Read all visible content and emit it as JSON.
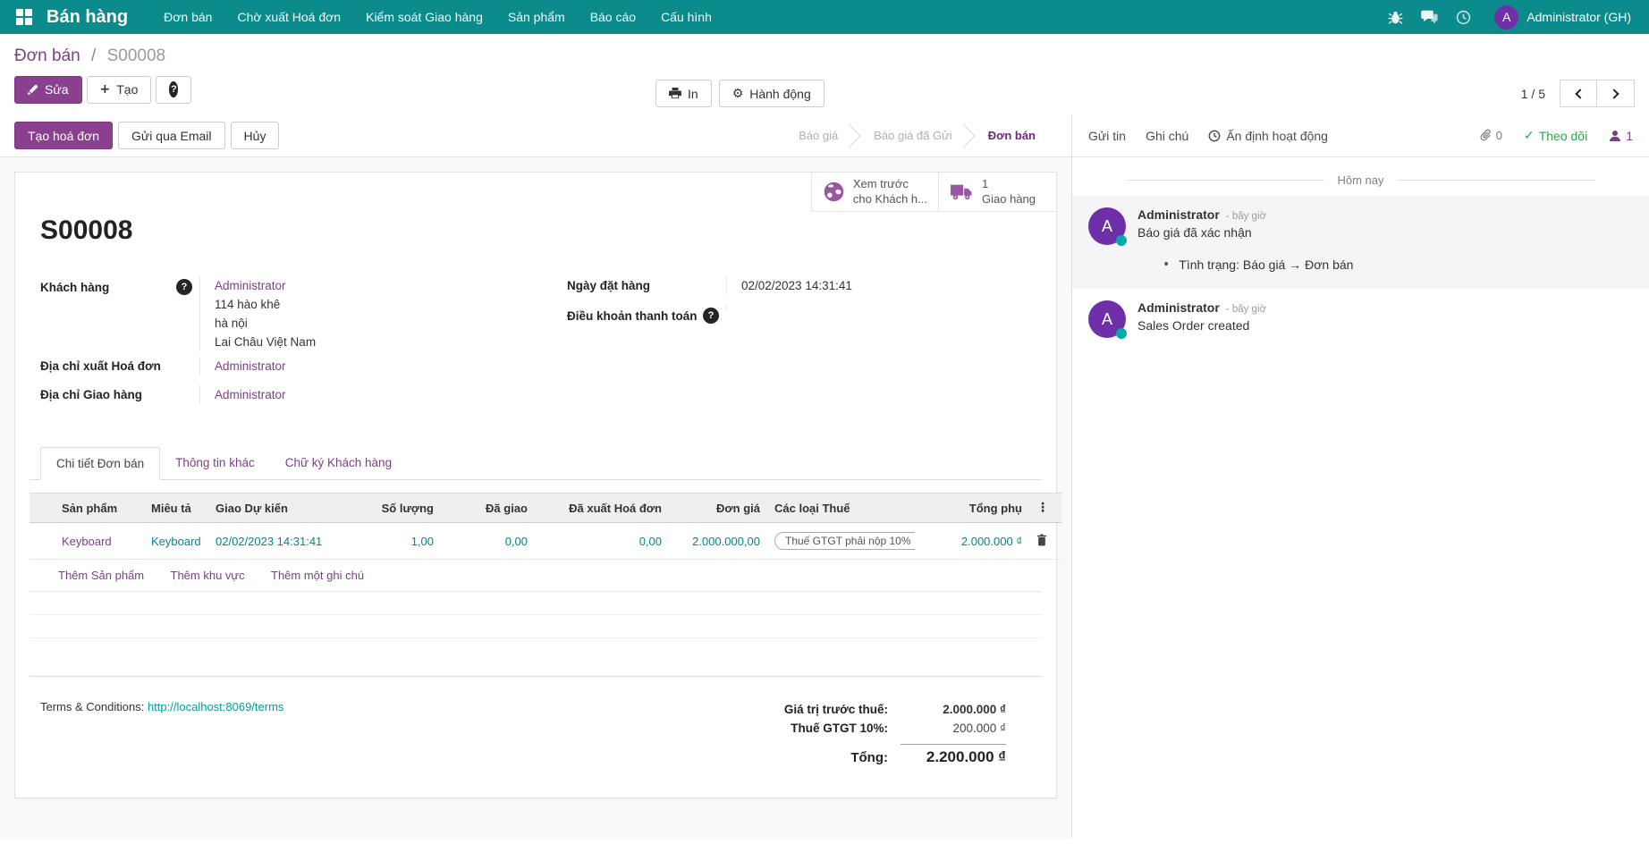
{
  "colors": {
    "nav_teal": "#0c8b8d",
    "accent_purple": "#8a3f8f",
    "link_purple": "#7c3f87",
    "value_teal": "#00878a",
    "terms_teal": "#00a09d",
    "follow_green": "#28a745",
    "avatar_purple": "#6e2fa8"
  },
  "nav": {
    "brand": "Bán hàng",
    "items": [
      "Đơn bán",
      "Chờ xuất Hoá đơn",
      "Kiểm soát Giao hàng",
      "Sản phẩm",
      "Báo cáo",
      "Cấu hình"
    ],
    "systray_icons": [
      "bug-icon",
      "chat-icon",
      "clock-icon"
    ],
    "user": {
      "initial": "A",
      "name": "Administrator (GH)"
    }
  },
  "breadcrumb": {
    "parent": "Đơn bán",
    "separator": "/",
    "current": "S00008"
  },
  "control_panel": {
    "edit_label": "Sửa",
    "create_label": "Tạo",
    "print_label": "In",
    "action_label": "Hành động",
    "pager_value": "1 / 5"
  },
  "statusbar": {
    "buttons": [
      {
        "label": "Tạo hoá đơn"
      },
      {
        "label": "Gửi qua Email"
      },
      {
        "label": "Hủy"
      }
    ],
    "stages": [
      {
        "label": "Báo giá"
      },
      {
        "label": "Báo giá đã Gửi"
      },
      {
        "label": "Đơn bán"
      }
    ]
  },
  "smart_buttons": [
    {
      "icon": "globe-icon",
      "line1": "Xem trước",
      "line2": "cho Khách h..."
    },
    {
      "icon": "truck-icon",
      "line1": "1",
      "line2": "Giao hàng"
    }
  ],
  "sheet": {
    "title": "S00008",
    "fields": {
      "customer_label": "Khách hàng",
      "customer_value": "Administrator",
      "address_lines": [
        "114 hào khê",
        "hà nội",
        "Lai Châu Việt Nam"
      ],
      "invoice_addr_label": "Địa chỉ xuất Hoá đơn",
      "invoice_addr_value": "Administrator",
      "delivery_addr_label": "Địa chỉ Giao hàng",
      "delivery_addr_value": "Administrator",
      "order_date_label": "Ngày đặt hàng",
      "order_date_value": "02/02/2023 14:31:41",
      "payment_terms_label": "Điều khoản thanh toán"
    },
    "tabs": [
      {
        "label": "Chi tiết Đơn bán"
      },
      {
        "label": "Thông tin khác"
      },
      {
        "label": "Chữ ký Khách hàng"
      }
    ],
    "table": {
      "headers": [
        "Sản phẩm",
        "Miêu tả",
        "Giao Dự kiến",
        "Số lượng",
        "Đã giao",
        "Đã xuất Hoá đơn",
        "Đơn giá",
        "Các loại Thuế",
        "Tổng phụ"
      ],
      "rows": [
        {
          "product": "Keyboard",
          "description": "Keyboard",
          "delivery_date": "02/02/2023 14:31:41",
          "qty": "1,00",
          "delivered": "0,00",
          "invoiced": "0,00",
          "unit_price": "2.000.000,00",
          "taxes": "Thuế GTGT phải nộp 10%",
          "subtotal": "2.000.000 ₫"
        }
      ],
      "add_links": [
        "Thêm Sản phẩm",
        "Thêm khu vực",
        "Thêm một ghi chú"
      ]
    },
    "terms_label": "Terms & Conditions:",
    "terms_link": "http://localhost:8069/terms",
    "totals": [
      {
        "label": "Giá trị trước thuế:",
        "value": "2.000.000 ₫"
      },
      {
        "label": "Thuế GTGT 10%:",
        "value": "200.000 ₫"
      },
      {
        "label": "Tổng:",
        "value": "2.200.000 ₫"
      }
    ]
  },
  "chatter": {
    "actions": [
      "Gửi tin",
      "Ghi chú",
      "Ấn định hoạt động"
    ],
    "attach_count": "0",
    "follow_label": "Theo dõi",
    "follower_count": "1",
    "date_divider": "Hôm nay",
    "messages": [
      {
        "author": "Administrator",
        "initial": "A",
        "time": "- bây giờ",
        "body": "Báo giá đã xác nhận",
        "tracking": "Tình trạng: Báo giá → Đơn bán"
      },
      {
        "author": "Administrator",
        "initial": "A",
        "time": "- bây giờ",
        "body": "Sales Order created",
        "tracking": ""
      }
    ]
  }
}
